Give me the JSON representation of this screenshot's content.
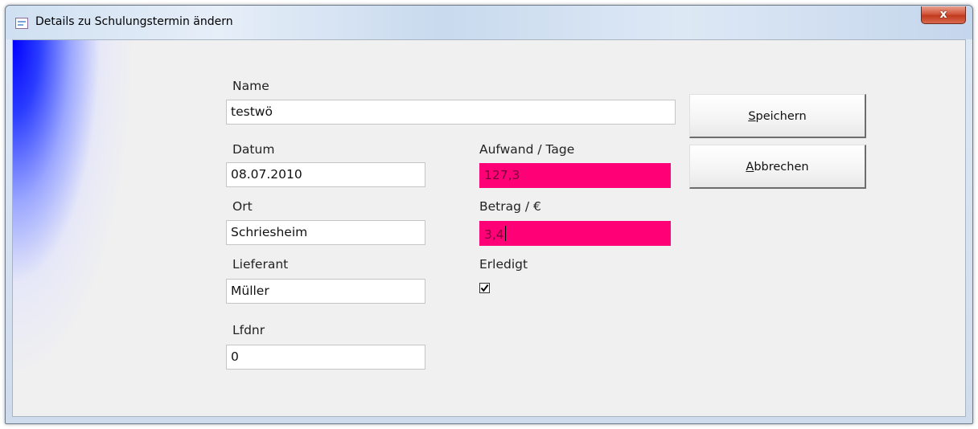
{
  "window": {
    "title": "Details zu Schulungstermin ändern",
    "close_label": "x"
  },
  "form": {
    "name_label": "Name",
    "name_value": "testwö",
    "datum_label": "Datum",
    "datum_value": "08.07.2010",
    "ort_label": "Ort",
    "ort_value": "Schriesheim",
    "lieferant_label": "Lieferant",
    "lieferant_value": "Müller",
    "lfdnr_label": "Lfdnr",
    "lfdnr_value": "0",
    "aufwand_label": "Aufwand / Tage",
    "aufwand_value": "127,3",
    "betrag_label": "Betrag / €",
    "betrag_value": "3,4",
    "erledigt_label": "Erledigt",
    "erledigt_checked": true
  },
  "buttons": {
    "save_label_first": "S",
    "save_label_rest": "peichern",
    "cancel_label_first": "A",
    "cancel_label_rest": "bbrechen"
  },
  "colors": {
    "highlight_field": "#ff0077",
    "form_background": "#f0f0f0",
    "glow_blue": "#0000ff"
  },
  "icons": {
    "title": "form-window-icon",
    "close": "close-icon",
    "checkmark": "checkmark-icon"
  }
}
